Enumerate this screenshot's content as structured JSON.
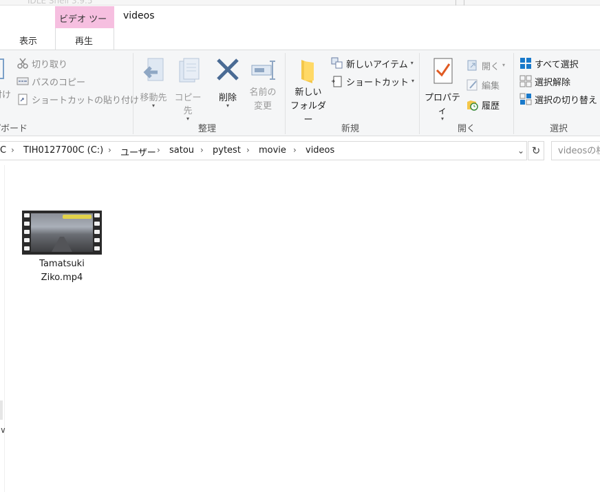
{
  "window": {
    "title": "videos"
  },
  "background_window": {
    "title_fragment": "IDLE Shell 3.9.5"
  },
  "tabs": {
    "context_header": "ビデオ ツール",
    "view": "表示",
    "play": "再生"
  },
  "ribbon": {
    "clipboard": {
      "label": "クリップボード",
      "paste_fragment": "付け",
      "cut": "切り取り",
      "copy_path": "パスのコピー",
      "paste_shortcut": "ショートカットの貼り付け"
    },
    "organize": {
      "label": "整理",
      "move_to": "移動先",
      "copy_to": "コピー先",
      "delete": "削除",
      "rename_line1": "名前の",
      "rename_line2": "変更"
    },
    "new": {
      "label": "新規",
      "new_item": "新しいアイテム",
      "shortcut": "ショートカット",
      "new_folder_line1": "新しい",
      "new_folder_line2": "フォルダー"
    },
    "open": {
      "label": "開く",
      "properties": "プロパティ",
      "open": "開く",
      "edit": "編集",
      "history": "履歴"
    },
    "select": {
      "label": "選択",
      "select_all": "すべて選択",
      "select_none": "選択解除",
      "invert": "選択の切り替え"
    }
  },
  "address": {
    "crumbs": [
      "C",
      "TIH0127700C (C:)",
      "ユーザー",
      "satou",
      "pytest",
      "movie",
      "videos"
    ]
  },
  "search": {
    "placeholder": "videosの検索"
  },
  "files": [
    {
      "name_line1": "Tamatsuki",
      "name_line2": "Ziko.mp4",
      "type": "video-thumbnail"
    }
  ],
  "colors": {
    "context_tab": "#f6bfe0",
    "ribbon_bg": "#f5f6f7",
    "accent_blue": "#1979ca",
    "delete_x": "#4a6b94"
  }
}
